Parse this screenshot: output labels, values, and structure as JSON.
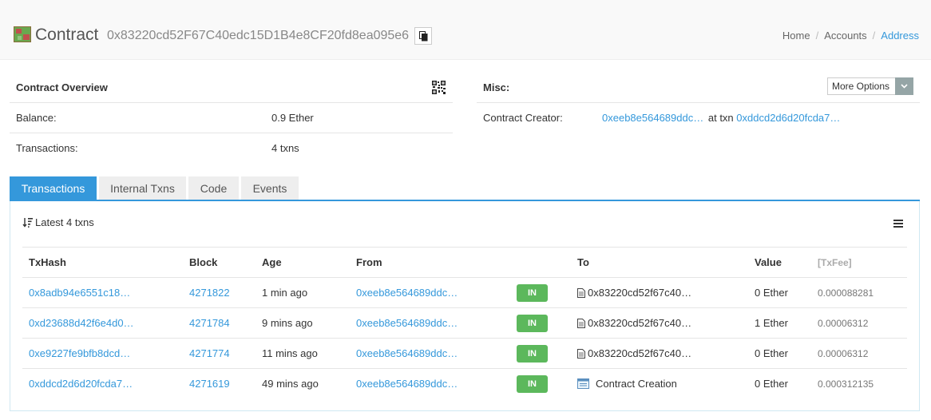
{
  "header": {
    "title": "Contract",
    "address": "0x83220cd52F67C40edc15D1B4e8CF20fd8ea095e6",
    "breadcrumb": [
      "Home",
      "Accounts",
      "Address"
    ]
  },
  "overview": {
    "title": "Contract Overview",
    "balance_label": "Balance:",
    "balance_value": "0.9 Ether",
    "transactions_label": "Transactions:",
    "transactions_value": "4 txns"
  },
  "misc": {
    "title": "Misc:",
    "more_options_label": "More Options",
    "creator_label": "Contract Creator:",
    "creator_address": "0xeeb8e564689ddc…",
    "at_txn_label": "at txn",
    "creator_txn": "0xddcd2d6d20fcda7…"
  },
  "tabs": [
    "Transactions",
    "Internal Txns",
    "Code",
    "Events"
  ],
  "table": {
    "summary": "Latest 4 txns",
    "columns": {
      "txhash": "TxHash",
      "block": "Block",
      "age": "Age",
      "from": "From",
      "to": "To",
      "value": "Value",
      "txfee": "[TxFee]"
    },
    "rows": [
      {
        "txhash": "0x8adb94e6551c18…",
        "block": "4271822",
        "age": "1 min ago",
        "from": "0xeeb8e564689ddc…",
        "direction": "IN",
        "to": "0x83220cd52f67c40…",
        "value": "0 Ether",
        "fee": "0.000088281"
      },
      {
        "txhash": "0xd23688d42f6e4d0…",
        "block": "4271784",
        "age": "9 mins ago",
        "from": "0xeeb8e564689ddc…",
        "direction": "IN",
        "to": "0x83220cd52f67c40…",
        "value": "1 Ether",
        "fee": "0.00006312"
      },
      {
        "txhash": "0xe9227fe9bfb8dcd…",
        "block": "4271774",
        "age": "11 mins ago",
        "from": "0xeeb8e564689ddc…",
        "direction": "IN",
        "to": "0x83220cd52f67c40…",
        "value": "0 Ether",
        "fee": "0.00006312"
      },
      {
        "txhash": "0xddcd2d6d20fcda7…",
        "block": "4271619",
        "age": "49 mins ago",
        "from": "0xeeb8e564689ddc…",
        "direction": "IN",
        "to": "Contract Creation",
        "value": "0 Ether",
        "fee": "0.000312135"
      }
    ]
  },
  "colors": {
    "accent": "#3498db",
    "in_badge": "#5cb85c",
    "more_options_caret": "#95a5a6"
  }
}
